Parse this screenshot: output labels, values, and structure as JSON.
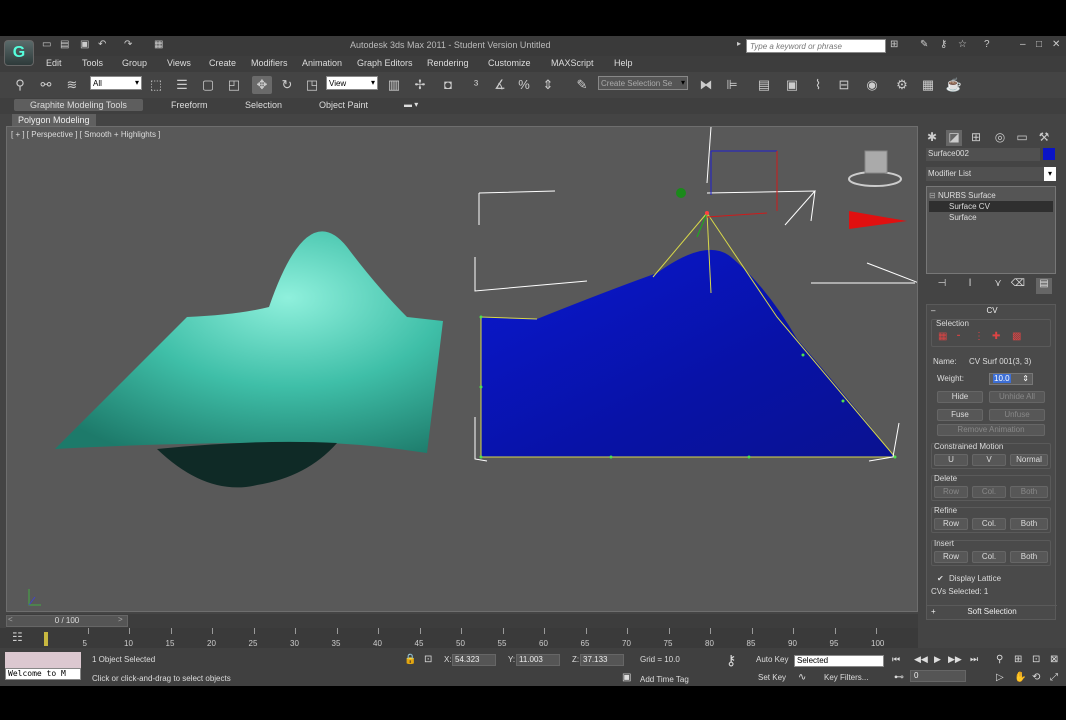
{
  "window": {
    "title": "Autodesk 3ds Max  2011  -  Student Version    Untitled",
    "search_placeholder": "Type a keyword or phrase"
  },
  "menus": [
    "Edit",
    "Tools",
    "Group",
    "Views",
    "Create",
    "Modifiers",
    "Animation",
    "Graph Editors",
    "Rendering",
    "Customize",
    "MAXScript",
    "Help"
  ],
  "toolbar": {
    "filter_value": "All",
    "refcoord_value": "View",
    "selection_set_placeholder": "Create Selection Se"
  },
  "ribbon": {
    "tabs": [
      "Graphite Modeling Tools",
      "Freeform",
      "Selection",
      "Object Paint"
    ],
    "active_tab": "Graphite Modeling Tools",
    "sub_panel": "Polygon Modeling"
  },
  "viewport": {
    "label": "[ + ] [ Perspective ] [ Smooth + Highlights ]",
    "colors": {
      "left_surface": "#3fbfa8",
      "right_surface": "#0a14b4",
      "lattice": "#d8d84a",
      "background": "#595959"
    }
  },
  "command_panel": {
    "object_name": "Surface002",
    "object_color": "#0a14c8",
    "modifier_list": "Modifier List",
    "stack": [
      {
        "label": "NURBS Surface",
        "selected": false
      },
      {
        "label": "Surface CV",
        "selected": true
      },
      {
        "label": "Surface",
        "selected": false
      }
    ],
    "rollout_title": "CV",
    "selection_label": "Selection",
    "name_label": "Name:",
    "name_value": "CV Surf 001(3, 3)",
    "weight_label": "Weight:",
    "weight_value": "10.0",
    "hide": "Hide",
    "unhide_all": "Unhide All",
    "fuse": "Fuse",
    "unfuse": "Unfuse",
    "remove_animation": "Remove Animation",
    "constrained_motion": "Constrained Motion",
    "cm_u": "U",
    "cm_v": "V",
    "cm_normal": "Normal",
    "delete_label": "Delete",
    "refine_label": "Refine",
    "insert_label": "Insert",
    "row": "Row",
    "col": "Col.",
    "both": "Both",
    "display_lattice": "Display Lattice",
    "display_lattice_checked": true,
    "cvs_selected": "CVs Selected: 1",
    "soft_selection": "Soft Selection"
  },
  "timeline": {
    "slider_text": "0 / 100",
    "ticks": [
      "5",
      "10",
      "15",
      "20",
      "25",
      "30",
      "35",
      "40",
      "45",
      "50",
      "55",
      "60",
      "65",
      "70",
      "75",
      "80",
      "85",
      "90",
      "95",
      "100"
    ]
  },
  "status": {
    "maxscript_text": "Welcome to M",
    "objects_selected": "1 Object Selected",
    "prompt": "Click or click-and-drag to select objects",
    "x_label": "X:",
    "x_value": "54.323",
    "y_label": "Y:",
    "y_value": "11.003",
    "z_label": "Z:",
    "z_value": "37.133",
    "grid": "Grid = 10.0",
    "auto_key": "Auto Key",
    "selected_set": "Selected",
    "set_key": "Set Key",
    "key_filters": "Key Filters...",
    "add_time_tag": "Add Time Tag",
    "frame": "0"
  }
}
